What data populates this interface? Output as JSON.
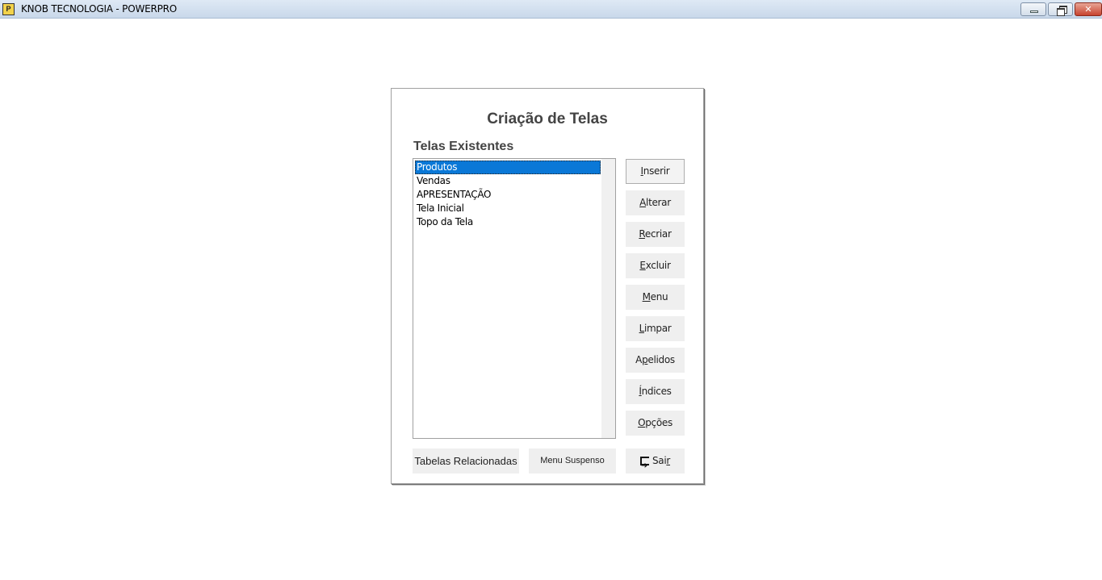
{
  "window": {
    "title": "KNOB TECNOLOGIA - POWERPRO",
    "controls": [
      "minimize",
      "restore",
      "close"
    ]
  },
  "dialog": {
    "title": "Criação de Telas",
    "list_label": "Telas Existentes",
    "list_items": [
      "Produtos",
      "Vendas",
      "APRESENTAÇÃO",
      "Tela Inicial",
      "Topo da Tela"
    ],
    "selected_item": "Produtos",
    "buttons": {
      "inserir": {
        "pre": "",
        "key": "I",
        "post": "nserir"
      },
      "alterar": {
        "pre": "",
        "key": "A",
        "post": "lterar"
      },
      "recriar": {
        "pre": "",
        "key": "R",
        "post": "ecriar"
      },
      "excluir": {
        "pre": "",
        "key": "E",
        "post": "xcluir"
      },
      "menu": {
        "pre": "",
        "key": "M",
        "post": "enu"
      },
      "limpar": {
        "pre": "",
        "key": "L",
        "post": "impar"
      },
      "apelidos": {
        "pre": "A",
        "key": "p",
        "post": "elidos"
      },
      "indices": {
        "pre": "",
        "key": "Í",
        "post": "ndices"
      },
      "opcoes": {
        "pre": "",
        "key": "O",
        "post": "pções"
      }
    },
    "bottom_buttons": {
      "tabelas": "Tabelas Relacionadas",
      "menu_suspenso": "Menu Suspenso",
      "sair": {
        "pre": "Sai",
        "key": "r",
        "post": ""
      }
    }
  },
  "icons": {
    "app": "powerpro-app-icon",
    "exit": "exit-door-icon"
  }
}
